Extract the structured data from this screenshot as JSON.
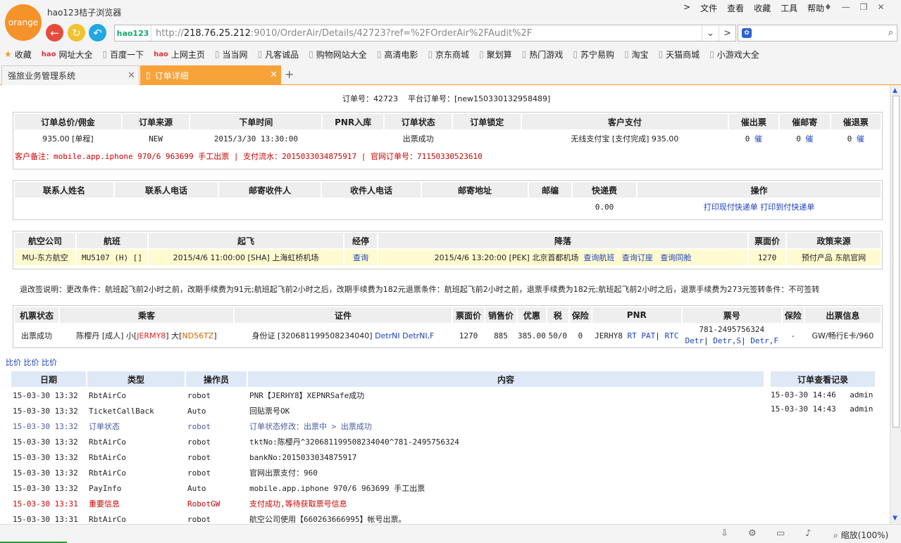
{
  "browser": {
    "logo": "orange",
    "title": "hao123桔子浏览器",
    "menus": [
      "文件",
      "查看",
      "收藏",
      "工具",
      "帮助"
    ],
    "url_badge": "hao123",
    "url_prefix": "http://",
    "url_host": "218.76.25.212",
    "url_rest": ":9010/OrderAir/Details/42723?ref=%2FOrderAir%2FAudit%2F"
  },
  "bookmarks": [
    "收藏",
    "网址大全",
    "百度一下",
    "上网主页",
    "当当网",
    "凡客诚品",
    "购物网站大全",
    "高清电影",
    "京东商城",
    "聚划算",
    "热门游戏",
    "苏宁易购",
    "淘宝",
    "天猫商城",
    "小游戏大全"
  ],
  "tabs": [
    {
      "label": "强旅业务管理系统"
    },
    {
      "label": "订单详细"
    }
  ],
  "order": {
    "no_label": "订单号：",
    "no": "42723",
    "platform_label": "平台订单号：",
    "platform_no": "[new150330132958489]"
  },
  "summary": {
    "headers": [
      "订单总价/佣金",
      "订单来源",
      "下单时间",
      "PNR入库",
      "订单状态",
      "订单锁定",
      "客户支付",
      "催出票",
      "催邮寄",
      "催退票"
    ],
    "row": {
      "price": "935.00 [单程]",
      "source": "NEW",
      "time": "2015/3/30 13:30:00",
      "pnr": "",
      "status": "出票成功",
      "lock": "",
      "pay": "无线支付宝 [支付完成] 935.00",
      "c1": "0",
      "c2": "0",
      "c3": "0",
      "urge": "催"
    },
    "remark": "客户备注：mobile.app.iphone 970/6 963699 手工出票 | 支付流水：2015033034875917 | 官网订单号：71150330523610"
  },
  "contact": {
    "headers": [
      "联系人姓名",
      "联系人电话",
      "邮寄收件人",
      "收件人电话",
      "邮寄地址",
      "邮编",
      "快递费",
      "操作"
    ],
    "fee": "0.00",
    "print1": "打印现付快递单",
    "print2": "打印到付快递单"
  },
  "flight": {
    "headers": [
      "航空公司",
      "航班",
      "起飞",
      "经停",
      "降落",
      "票面价",
      "政策来源"
    ],
    "airline": "MU-东方航空",
    "flightno": "MU5107 (H) []",
    "depart": "2015/4/6 11:00:00 [SHA] 上海虹桥机场",
    "stop": "查询",
    "arrive": "2015/4/6 13:20:00 [PEK] 北京首都机场",
    "q1": "查询航班",
    "q2": "查询订座",
    "q3": "查询同舱",
    "price": "1270",
    "policy": "预付产品 东航官网"
  },
  "rules": "退改签说明：更改条件：航班起飞前2小时之前，改期手续费为91元;航班起飞前2小时之后，改期手续费为182元退票条件：航班起飞前2小时之前，退票手续费为182元;航班起飞前2小时之后，退票手续费为273元签转条件：不可签转",
  "passenger": {
    "headers": [
      "机票状态",
      "乘客",
      "证件",
      "票面价",
      "销售价",
      "优惠",
      "税",
      "保险",
      "PNR",
      "票号",
      "保险",
      "出票信息"
    ],
    "status": "出票成功",
    "name": "陈樱丹 [成人] 小[",
    "small_pnr": "JERMY8",
    "mid": "] 大[",
    "big_pnr": "ND56TZ",
    "end": "]",
    "id_text": "身份证 [320681199508234040]",
    "detr1": "DetrNI",
    "detr2": "DetrNI,F",
    "face": "1270",
    "sale": "885",
    "discount": "385.00",
    "tax": "50/0",
    "ins": "0",
    "pnr": "JERHY8",
    "rt": "RT",
    "pat": "PAT",
    "rtc": "RTC",
    "ticket": "781-2495756324",
    "tdetr": "Detr",
    "tdetrs": "Detr,S",
    "tdetrf": "Detr,F",
    "ins2": "-",
    "issue": "GW/畅行E卡/960"
  },
  "price_links": [
    "比价",
    "比价",
    "比价"
  ],
  "log": {
    "headers": [
      "日期",
      "类型",
      "操作员",
      "内容"
    ],
    "rows": [
      {
        "date": "15-03-30 13:32",
        "type": "RbtAirCo",
        "op": "robot",
        "text": "PNR【JERHY8】XEPNRSafe成功",
        "style": ""
      },
      {
        "date": "15-03-30 13:32",
        "type": "TicketCallBack",
        "op": "Auto",
        "text": "回贴票号OK",
        "style": ""
      },
      {
        "date": "15-03-30 13:32",
        "type": "订单状态",
        "op": "robot",
        "text": "订单状态修改：出票中 > 出票成功",
        "style": "status"
      },
      {
        "date": "15-03-30 13:32",
        "type": "RbtAirCo",
        "op": "robot",
        "text": "tktNo:陈樱丹^320681199508234040^781-2495756324",
        "style": ""
      },
      {
        "date": "15-03-30 13:32",
        "type": "RbtAirCo",
        "op": "robot",
        "text": "bankNo:2015033034875917",
        "style": ""
      },
      {
        "date": "15-03-30 13:32",
        "type": "RbtAirCo",
        "op": "robot",
        "text": "官网出票支付：960",
        "style": ""
      },
      {
        "date": "15-03-30 13:32",
        "type": "PayInfo",
        "op": "Auto",
        "text": "mobile.app.iphone 970/6 963699 手工出票",
        "style": ""
      },
      {
        "date": "15-03-30 13:31",
        "type": "重要信息",
        "op": "RobotGW",
        "text": "支付成功,等待获取票号信息",
        "style": "important"
      },
      {
        "date": "15-03-30 13:31",
        "type": "RbtAirCo",
        "op": "robot",
        "text": "航空公司使用【660263666995】帐号出票。",
        "style": ""
      }
    ]
  },
  "view_log": {
    "title": "订单查看记录",
    "rows": [
      {
        "time": "15-03-30 14:46",
        "user": "admin"
      },
      {
        "time": "15-03-30 14:43",
        "user": "admin"
      }
    ]
  },
  "status_bar": {
    "zoom": "缩放(100%)"
  }
}
